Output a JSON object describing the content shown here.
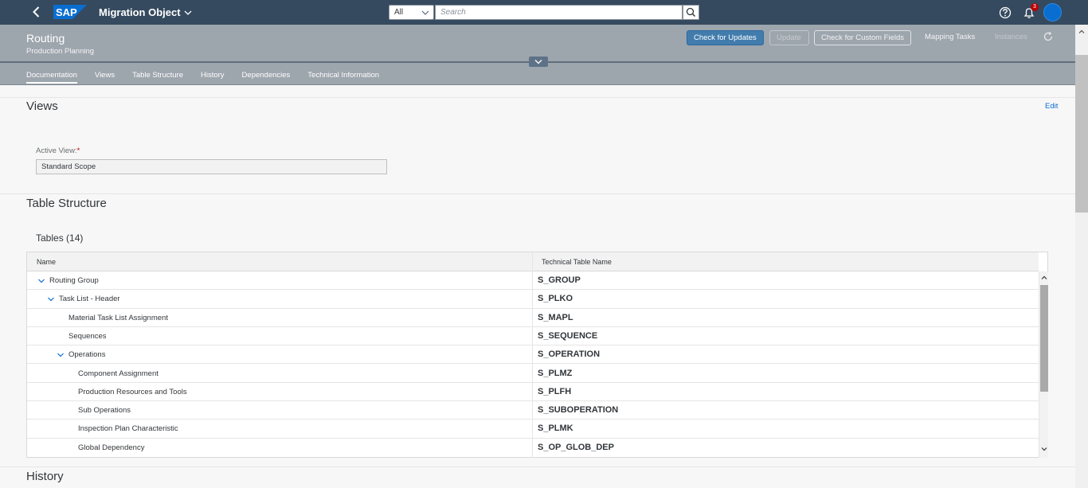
{
  "shell": {
    "logo_text": "SAP",
    "app_title": "Migration Object",
    "search_scope": "All",
    "search_placeholder": "Search",
    "notification_count": "3",
    "colors": {
      "shell_bg": "#354a5f",
      "logo_blue": "#0a6ed1",
      "avatar": "#0a6ed1"
    }
  },
  "header": {
    "title": "Routing",
    "subtitle": "Production Planning",
    "actions": {
      "check_updates": "Check for Updates",
      "update": "Update",
      "check_custom_fields": "Check for Custom Fields",
      "mapping_tasks": "Mapping Tasks",
      "instances": "Instances"
    },
    "tabs": [
      {
        "label": "Documentation",
        "active": true
      },
      {
        "label": "Views"
      },
      {
        "label": "Table Structure"
      },
      {
        "label": "History"
      },
      {
        "label": "Dependencies"
      },
      {
        "label": "Technical Information"
      }
    ]
  },
  "views": {
    "title": "Views",
    "edit_label": "Edit",
    "active_view_label": "Active View:",
    "required_marker": "*",
    "active_view_value": "Standard Scope"
  },
  "table_structure": {
    "title": "Table Structure",
    "tables_title": "Tables (14)",
    "columns": [
      "Name",
      "Technical Table Name"
    ],
    "rows": [
      {
        "name": "Routing Group",
        "technical": "S_GROUP",
        "level": 0,
        "expandable": true
      },
      {
        "name": "Task List - Header",
        "technical": "S_PLKO",
        "level": 1,
        "expandable": true
      },
      {
        "name": "Material Task List Assignment",
        "technical": "S_MAPL",
        "level": 2,
        "expandable": false
      },
      {
        "name": "Sequences",
        "technical": "S_SEQUENCE",
        "level": 2,
        "expandable": false
      },
      {
        "name": "Operations",
        "technical": "S_OPERATION",
        "level": 2,
        "expandable": true
      },
      {
        "name": "Component Assignment",
        "technical": "S_PLMZ",
        "level": 3,
        "expandable": false
      },
      {
        "name": "Production Resources and Tools",
        "technical": "S_PLFH",
        "level": 3,
        "expandable": false
      },
      {
        "name": "Sub Operations",
        "technical": "S_SUBOPERATION",
        "level": 3,
        "expandable": false
      },
      {
        "name": "Inspection Plan Characteristic",
        "technical": "S_PLMK",
        "level": 3,
        "expandable": false
      },
      {
        "name": "Global Dependency",
        "technical": "S_OP_GLOB_DEP",
        "level": 3,
        "expandable": false
      }
    ]
  },
  "history": {
    "title": "History"
  }
}
